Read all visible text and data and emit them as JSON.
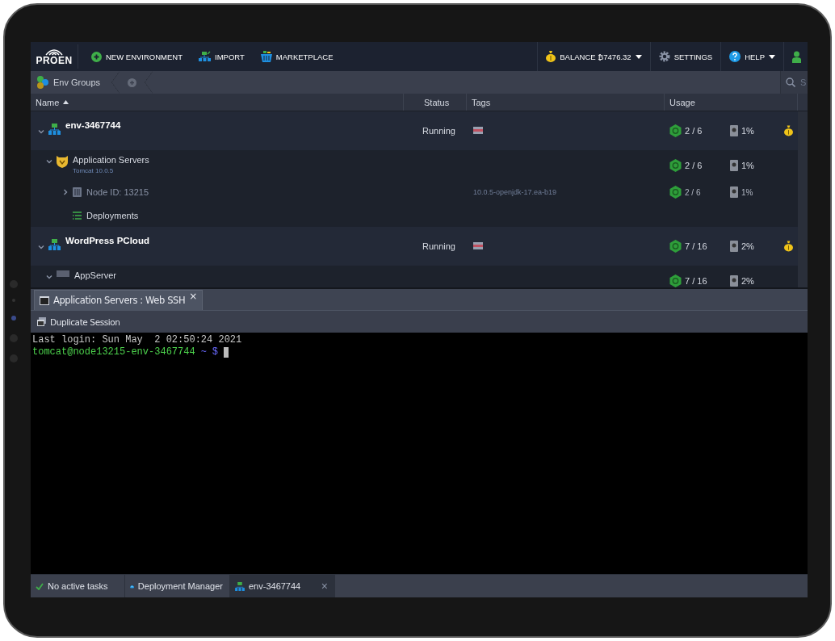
{
  "top_bar": {
    "logo": "PROEN",
    "actions": [
      {
        "kind": "new",
        "label": "NEW ENVIRONMENT"
      },
      {
        "kind": "import",
        "label": "IMPORT"
      },
      {
        "kind": "marketplace",
        "label": "MARKETPLACE"
      }
    ],
    "right_actions": [
      {
        "kind": "balance",
        "label": "BALANCE ₿7476.32",
        "dropdown": true
      },
      {
        "kind": "settings",
        "label": "SETTINGS",
        "dropdown": false
      },
      {
        "kind": "help",
        "label": "HELP",
        "dropdown": true
      }
    ]
  },
  "breadcrumb": {
    "label": "Env Groups"
  },
  "search": {
    "placeholder": "S"
  },
  "table": {
    "columns": [
      {
        "label": "Name",
        "sorted": true
      },
      {
        "label": "Status",
        "sorted": false
      },
      {
        "label": "Tags",
        "sorted": false
      },
      {
        "label": "Usage",
        "sorted": false
      }
    ],
    "environments": [
      {
        "kind": "env",
        "name": "env-3467744",
        "expanded": true,
        "status": "Running",
        "cloudlets": "2 / 6",
        "disk": "1%",
        "children": [
          {
            "kind": "group",
            "name": "Application Servers",
            "subtitle": "Tomcat 10.0.5",
            "expanded": true,
            "cloudlets": "2 / 6",
            "disk": "1%",
            "children": [
              {
                "kind": "node",
                "name": "Node ID: 13215",
                "expanded": false,
                "tag": "10.0.5-openjdk-17.ea-b19",
                "cloudlets": "2 / 6",
                "disk": "1%"
              },
              {
                "kind": "deployments",
                "name": "Deployments"
              }
            ]
          }
        ]
      },
      {
        "kind": "env",
        "name": "WordPress PCloud",
        "expanded": true,
        "status": "Running",
        "cloudlets": "7 / 16",
        "disk": "2%",
        "children": [
          {
            "kind": "group",
            "name": "AppServer",
            "expanded": true,
            "cloudlets": "7 / 16",
            "disk": "2%"
          }
        ]
      }
    ]
  },
  "ssh_panel": {
    "tab": {
      "title": "Application Servers : Web SSH",
      "close": "×"
    },
    "toolbar": {
      "label": "Duplicate Session"
    },
    "terminal": [
      {
        "kind": "output",
        "text": "Last login: Sun May  2 02:50:24 2021"
      },
      {
        "kind": "prompt",
        "user": "tomcat@node13215-env-3467744",
        "path": "~",
        "symbol": "$"
      }
    ]
  },
  "status_bar": [
    {
      "kind": "tasks",
      "label": "No active tasks",
      "selected": false
    },
    {
      "kind": "deployment",
      "label": "Deployment Manager",
      "selected": false
    },
    {
      "kind": "env",
      "label": "env-3467744",
      "close": "×",
      "selected": true
    }
  ]
}
